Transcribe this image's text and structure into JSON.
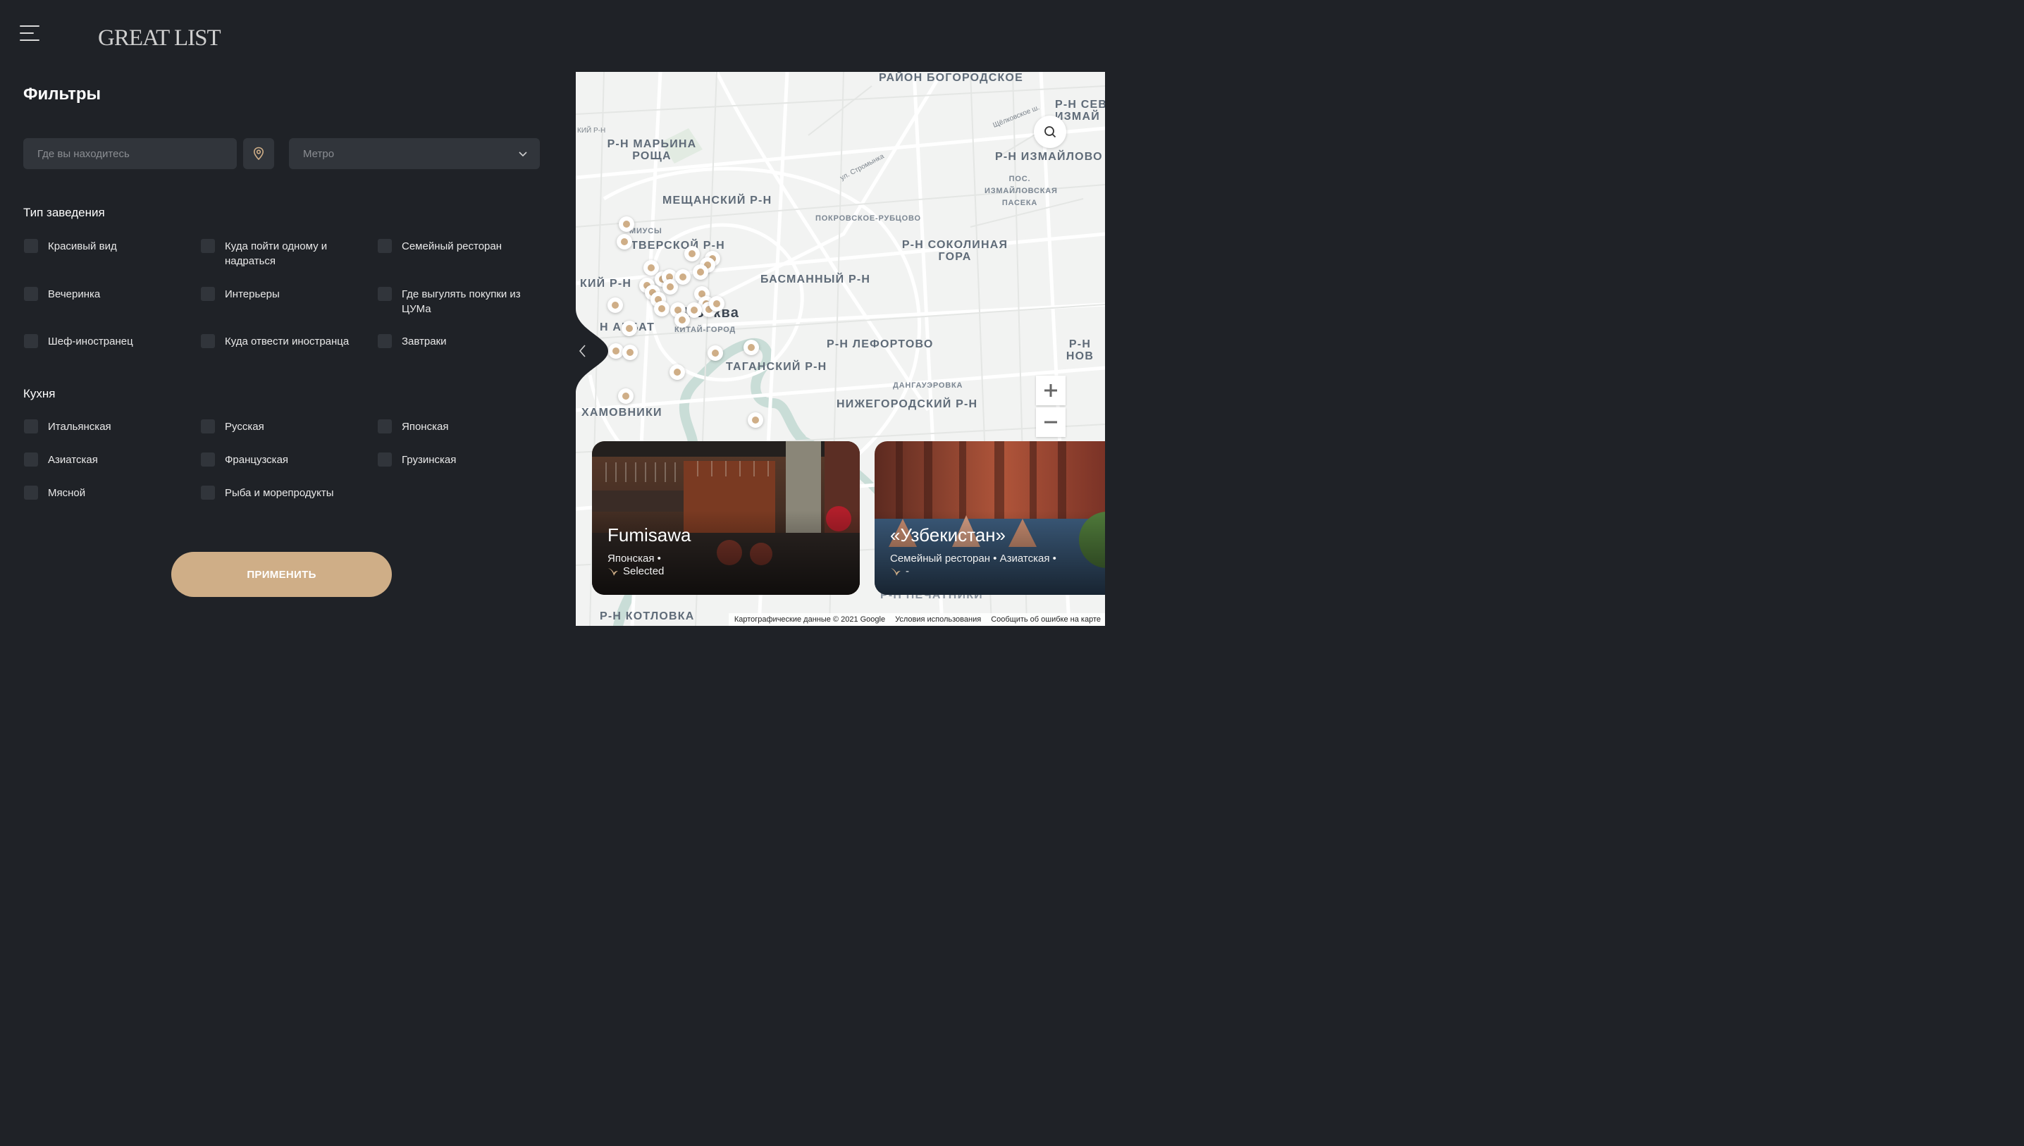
{
  "header": {
    "logo": "GREAT LIST"
  },
  "filters": {
    "title": "Фильтры",
    "location_placeholder": "Где вы находитесь",
    "metro_placeholder": "Метро",
    "venue_type": {
      "title": "Тип заведения",
      "options": [
        "Красивый вид",
        "Куда пойти одному и надраться",
        "Семейный ресторан",
        "Вечеринка",
        "Интерьеры",
        "Где выгулять покупки из ЦУМа",
        "Шеф-иностранец",
        "Куда отвести иностранца",
        "Завтраки"
      ]
    },
    "cuisine": {
      "title": "Кухня",
      "options": [
        "Итальянская",
        "Русская",
        "Японская",
        "Азиатская",
        "Французская",
        "Грузинская",
        "Мясной",
        "Рыба и морепродукты"
      ]
    },
    "apply_label": "ПРИМЕНИТЬ"
  },
  "map": {
    "districts": [
      "РАЙОН БОГОРОДСКОЕ",
      "Р-Н СЕВ ИЗМАЙ",
      "Р-Н МАРЬИНА РОЩА",
      "Р-Н ИЗМАЙЛОВО",
      "ПОС. ИЗМАЙЛОВСКАЯ ПАСЕКА",
      "МЕЩАНСКИЙ Р-Н",
      "ПОКРОВСКОЕ-РУБЦОВО",
      "ТВЕРСКОЙ Р-Н",
      "Р-Н СОКОЛИНАЯ ГОРА",
      "БАСМАННЫЙ Р-Н",
      "КИЙ Р-Н",
      "Москва",
      "Н АРБАТ",
      "КИТАЙ-ГОРОД",
      "Р-Н ЛЕФОРТОВО",
      "Р-Н НОВ",
      "ТАГАНСКИЙ Р-Н",
      "ДАНГАУЭРОВКА",
      "НИЖЕГОРОДСКИЙ Р-Н",
      "ХАМОВНИКИ",
      "Р-Н КОТЛОВКА",
      "МИУСЫ",
      "Р-Н ПЕЧАТНИКИ"
    ],
    "streets": [
      "Щёлковское ш.",
      "ул. Стромынка",
      "КИЙ Р-Н"
    ],
    "attribution": {
      "data": "Картографические данные © 2021 Google",
      "terms": "Условия использования",
      "report": "Сообщить об ошибке на карте"
    }
  },
  "cards": [
    {
      "name": "Fumisawa",
      "tags": "Японская •",
      "badge": "Selected"
    },
    {
      "name": "«Узбекистан»",
      "tags": "Семейный ресторан • Азиатская •",
      "badge": "-"
    }
  ],
  "colors": {
    "background": "#1f2227",
    "field": "#31353b",
    "accent": "#cfae87",
    "map_bg": "#f2f3f2"
  }
}
